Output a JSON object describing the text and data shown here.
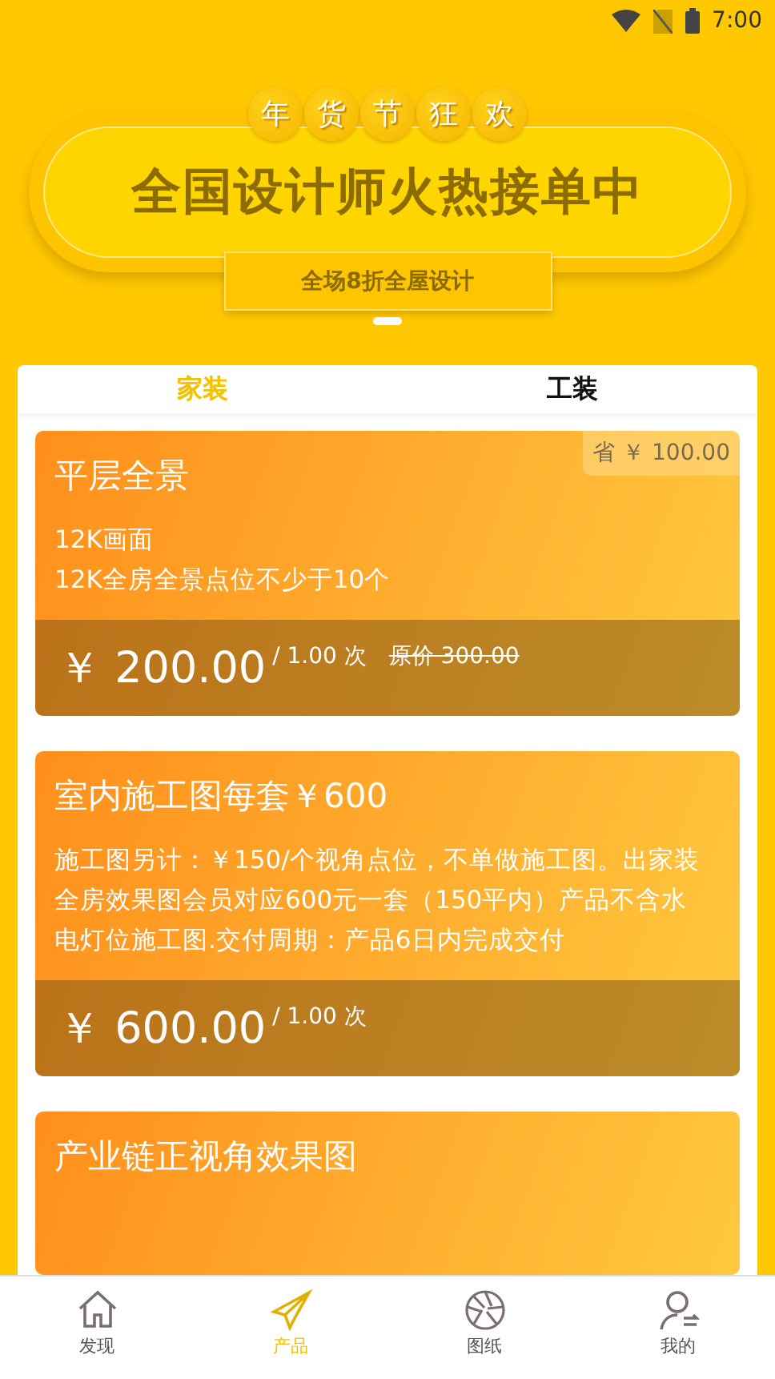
{
  "status_bar": {
    "time": "7:00"
  },
  "banner": {
    "badge_chars": [
      "年",
      "货",
      "节",
      "狂",
      "欢"
    ],
    "title": "全国设计师火热接单中",
    "subtitle": "全场8折全屋设计"
  },
  "tabs": [
    {
      "label": "家装",
      "selected": true
    },
    {
      "label": "工装",
      "selected": false
    }
  ],
  "products": [
    {
      "title": "平层全景",
      "savings": "省 ￥ 100.00",
      "lines": [
        "12K画面",
        "12K全房全景点位不少于10个"
      ],
      "price": "￥ 200.00",
      "unit": "/ 1.00 次",
      "original_price": "原价 300.00"
    },
    {
      "title": "室内施工图每套￥600",
      "lines": [
        "施工图另计：￥150/个视角点位，不单做施工图。出家装全房效果图会员对应600元一套（150平内）产品不含水电灯位施工图.交付周期：产品6日内完成交付"
      ],
      "price": "￥ 600.00",
      "unit": "/ 1.00 次"
    },
    {
      "title": "产业链正视角效果图"
    }
  ],
  "nav": [
    {
      "label": "发现",
      "kind": "home",
      "selected": false
    },
    {
      "label": "产品",
      "kind": "plane",
      "selected": true
    },
    {
      "label": "图纸",
      "kind": "aperture",
      "selected": false
    },
    {
      "label": "我的",
      "kind": "user",
      "selected": false
    }
  ]
}
